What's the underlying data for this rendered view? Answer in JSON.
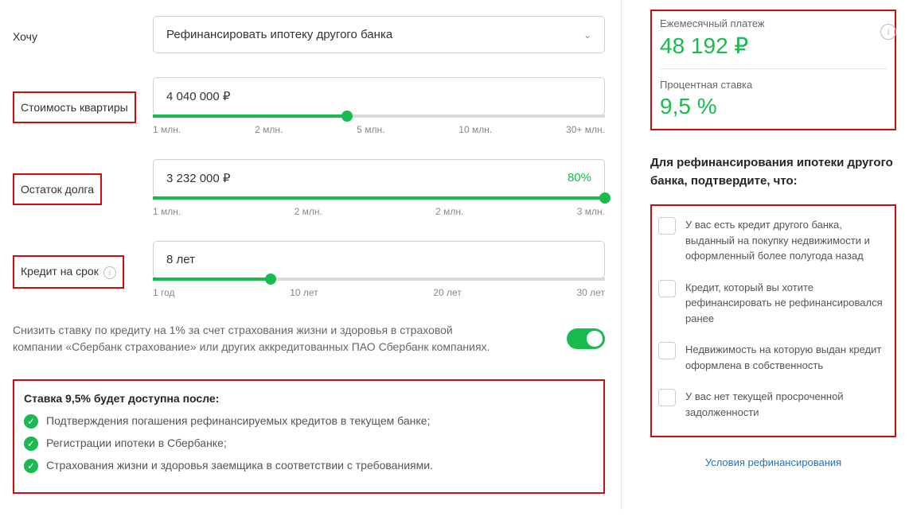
{
  "want": {
    "label": "Хочу",
    "value": "Рефинансировать ипотеку другого банка"
  },
  "price": {
    "label": "Стоимость квартиры",
    "value": "4 040 000 ₽",
    "ticks": [
      "1 млн.",
      "2 млн.",
      "5 млн.",
      "10 млн.",
      "30+ млн."
    ],
    "fill_pct": 43
  },
  "debt": {
    "label": "Остаток долга",
    "value": "3 232 000 ₽",
    "percent": "80%",
    "ticks": [
      "1 млн.",
      "2 млн.",
      "2 млн.",
      "3 млн."
    ],
    "fill_pct": 100
  },
  "term": {
    "label": "Кредит на срок",
    "value": "8 лет",
    "ticks": [
      "1 год",
      "10 лет",
      "20 лет",
      "30 лет"
    ],
    "fill_pct": 26
  },
  "insurance": {
    "text": "Снизить ставку по кредиту на 1% за счет страхования жизни и здоровья в страховой компании «Сбербанк страхование» или других аккредитованных ПАО Сбербанк компаниях.",
    "on": true
  },
  "rate_info": {
    "title": "Ставка 9,5% будет доступна после:",
    "items": [
      "Подтверждения погашения рефинансируемых кредитов в текущем банке;",
      "Регистрации ипотеки в Сбербанке;",
      "Страхования жизни и здоровья заемщика в соответствии с требованиями."
    ]
  },
  "summary": {
    "payment_label": "Ежемесячный платеж",
    "payment_value": "48 192 ₽",
    "rate_label": "Процентная ставка",
    "rate_value": "9,5 %"
  },
  "confirm": {
    "title": "Для рефинансирования ипотеки другого банка, подтвердите, что:",
    "items": [
      "У вас есть кредит другого банка, выданный на покупку недвижимости и оформленный более полугода назад",
      "Кредит, который вы хотите рефинансировать не рефинансировался ранее",
      "Недвижимость на которую выдан кредит оформлена в собственность",
      "У вас нет текущей просроченной задолженности"
    ]
  },
  "link": "Условия рефинансирования"
}
